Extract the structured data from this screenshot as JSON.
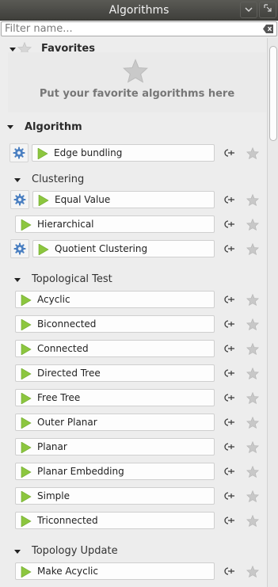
{
  "window": {
    "title": "Algorithms"
  },
  "filter": {
    "placeholder": "Filter name...",
    "value": ""
  },
  "favorites": {
    "title": "Favorites",
    "empty_message": "Put your favorite algorithms here"
  },
  "algorithm": {
    "title": "Algorithm",
    "items": [
      {
        "label": "Edge bundling",
        "has_settings": true
      }
    ],
    "groups": [
      {
        "title": "Clustering",
        "items": [
          {
            "label": "Equal Value",
            "has_settings": true
          },
          {
            "label": "Hierarchical",
            "has_settings": false
          },
          {
            "label": "Quotient Clustering",
            "has_settings": true
          }
        ]
      },
      {
        "title": "Topological Test",
        "items": [
          {
            "label": "Acyclic",
            "has_settings": false
          },
          {
            "label": "Biconnected",
            "has_settings": false
          },
          {
            "label": "Connected",
            "has_settings": false
          },
          {
            "label": "Directed Tree",
            "has_settings": false
          },
          {
            "label": "Free Tree",
            "has_settings": false
          },
          {
            "label": "Outer Planar",
            "has_settings": false
          },
          {
            "label": "Planar",
            "has_settings": false
          },
          {
            "label": "Planar Embedding",
            "has_settings": false
          },
          {
            "label": "Simple",
            "has_settings": false
          },
          {
            "label": "Triconnected",
            "has_settings": false
          }
        ]
      },
      {
        "title": "Topology Update",
        "items": [
          {
            "label": "Make Acyclic",
            "has_settings": false
          }
        ]
      }
    ]
  },
  "colors": {
    "play": "#8cc63f",
    "gear": "#4a7fc1",
    "star": "#c8c8c8"
  },
  "icons": {
    "row_action": "pin-icon",
    "row_favorite": "star-icon",
    "run": "play-icon",
    "settings": "gear-icon"
  }
}
